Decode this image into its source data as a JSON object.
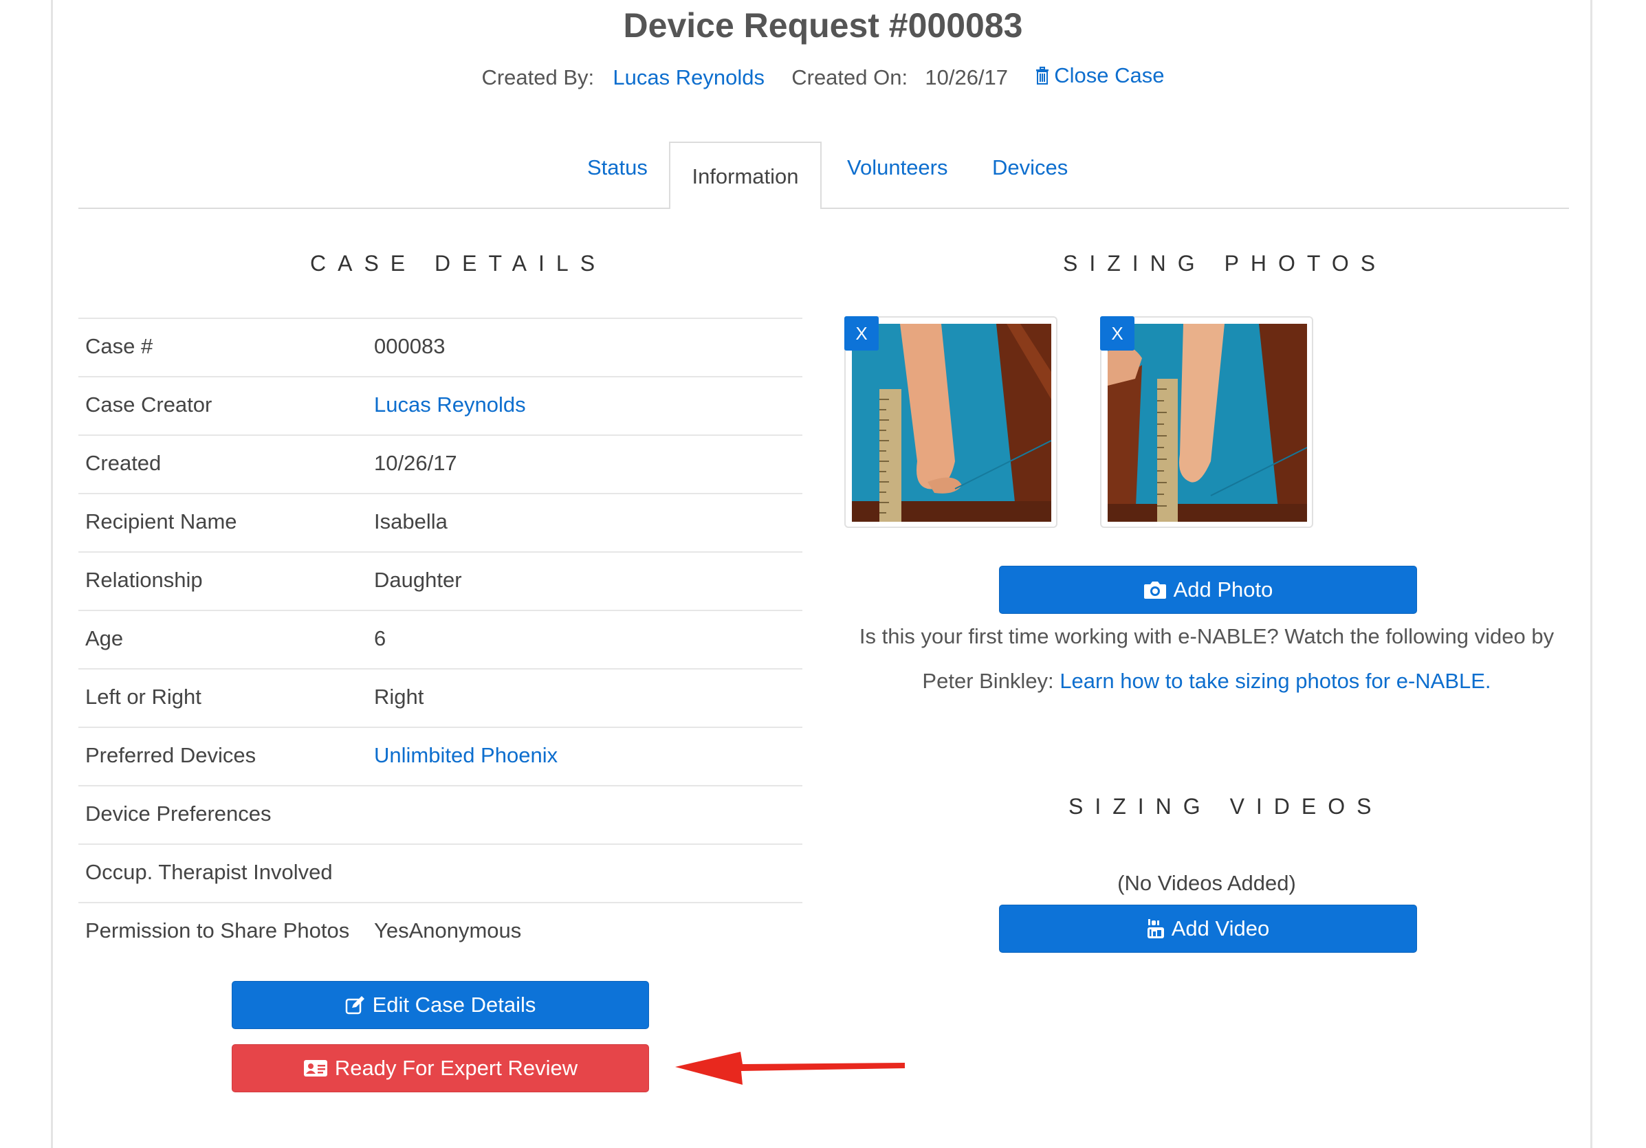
{
  "header": {
    "title": "Device Request #000083",
    "created_by_label": "Created By:",
    "created_by_name": "Lucas Reynolds",
    "created_on_label": "Created On:",
    "created_on_value": "10/26/17",
    "close_case": "Close Case"
  },
  "tabs": [
    {
      "label": "Status",
      "active": false
    },
    {
      "label": "Information",
      "active": true
    },
    {
      "label": "Volunteers",
      "active": false
    },
    {
      "label": "Devices",
      "active": false
    }
  ],
  "case_details": {
    "title": "CASE DETAILS",
    "rows": [
      {
        "label": "Case #",
        "value": "000083"
      },
      {
        "label": "Case Creator",
        "value": "Lucas Reynolds"
      },
      {
        "label": "Created",
        "value": "10/26/17"
      },
      {
        "label": "Recipient Name",
        "value": "Isabella"
      },
      {
        "label": "Relationship",
        "value": "Daughter"
      },
      {
        "label": "Age",
        "value": "6"
      },
      {
        "label": "Left or Right",
        "value": "Right"
      },
      {
        "label": "Preferred Devices",
        "value": "Unlimbited Phoenix"
      },
      {
        "label": "Device Preferences",
        "value": ""
      },
      {
        "label": "Occup. Therapist Involved",
        "value": ""
      },
      {
        "label": "Permission to Share Photos",
        "value": "YesAnonymous"
      }
    ],
    "edit_button": "Edit Case Details",
    "review_button": "Ready For Expert Review"
  },
  "sizing_photos": {
    "title": "SIZING PHOTOS",
    "remove_label": "X",
    "add_button": "Add Photo",
    "help_line1": "Is this your first time working with e-NABLE? Watch the following video by",
    "help_line2_prefix": "Peter Binkley:",
    "help_link": "Learn how to take sizing photos for e-NABLE."
  },
  "sizing_videos": {
    "title": "SIZING VIDEOS",
    "empty_text": "(No Videos Added)",
    "add_button": "Add Video"
  },
  "colors": {
    "link": "#0d6ece",
    "primary_button": "#0d73d8",
    "danger_button": "#e64549",
    "annotation_arrow": "#e8281e"
  },
  "icons": {
    "close_case": "trash-icon",
    "edit": "edit-icon",
    "review": "id-card-icon",
    "add_photo": "camera-icon",
    "add_video": "youtube-icon"
  }
}
